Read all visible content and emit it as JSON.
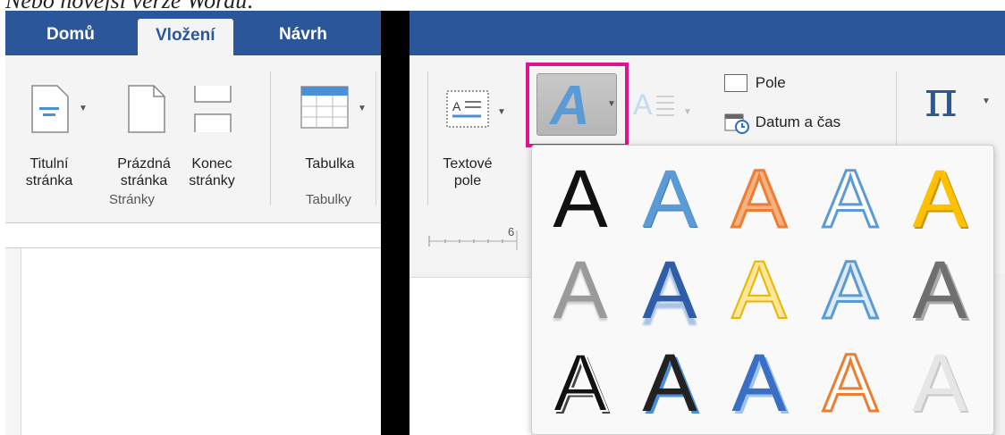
{
  "caption": "Nebo novější verze Wordu:",
  "tabs": [
    {
      "label": "Domů"
    },
    {
      "label": "Vložení"
    },
    {
      "label": "Návrh"
    }
  ],
  "pages_group": {
    "buttons": [
      {
        "line1": "Titulní",
        "line2": "stránka"
      },
      {
        "line1": "Prázdná",
        "line2": "stránka"
      },
      {
        "line1": "Konec",
        "line2": "stránky"
      }
    ],
    "label": "Stránky"
  },
  "tables_group": {
    "button": "Tabulka",
    "label": "Tabulky"
  },
  "text_group": {
    "textbox": {
      "line1": "Textové",
      "line2": "pole"
    },
    "field": "Pole",
    "datetime": "Datum a čas"
  },
  "ruler": {
    "mark": "6"
  },
  "gallery": {
    "styles": [
      {
        "glyph": "A"
      },
      {
        "glyph": "A"
      },
      {
        "glyph": "A"
      },
      {
        "glyph": "A"
      },
      {
        "glyph": "A"
      },
      {
        "glyph": "A"
      },
      {
        "glyph": "A"
      },
      {
        "glyph": "A"
      },
      {
        "glyph": "A"
      },
      {
        "glyph": "A"
      },
      {
        "glyph": "A"
      },
      {
        "glyph": "A"
      },
      {
        "glyph": "A"
      },
      {
        "glyph": "A"
      },
      {
        "glyph": "A"
      }
    ]
  },
  "colors": {
    "ribbon_blue": "#2b579a",
    "highlight": "#e0148a",
    "accent_blue": "#5b9bd5",
    "orange": "#ed7d31",
    "gold": "#ffc000"
  },
  "icons": {
    "wordart": "wordart-icon",
    "equation": "pi-icon"
  }
}
